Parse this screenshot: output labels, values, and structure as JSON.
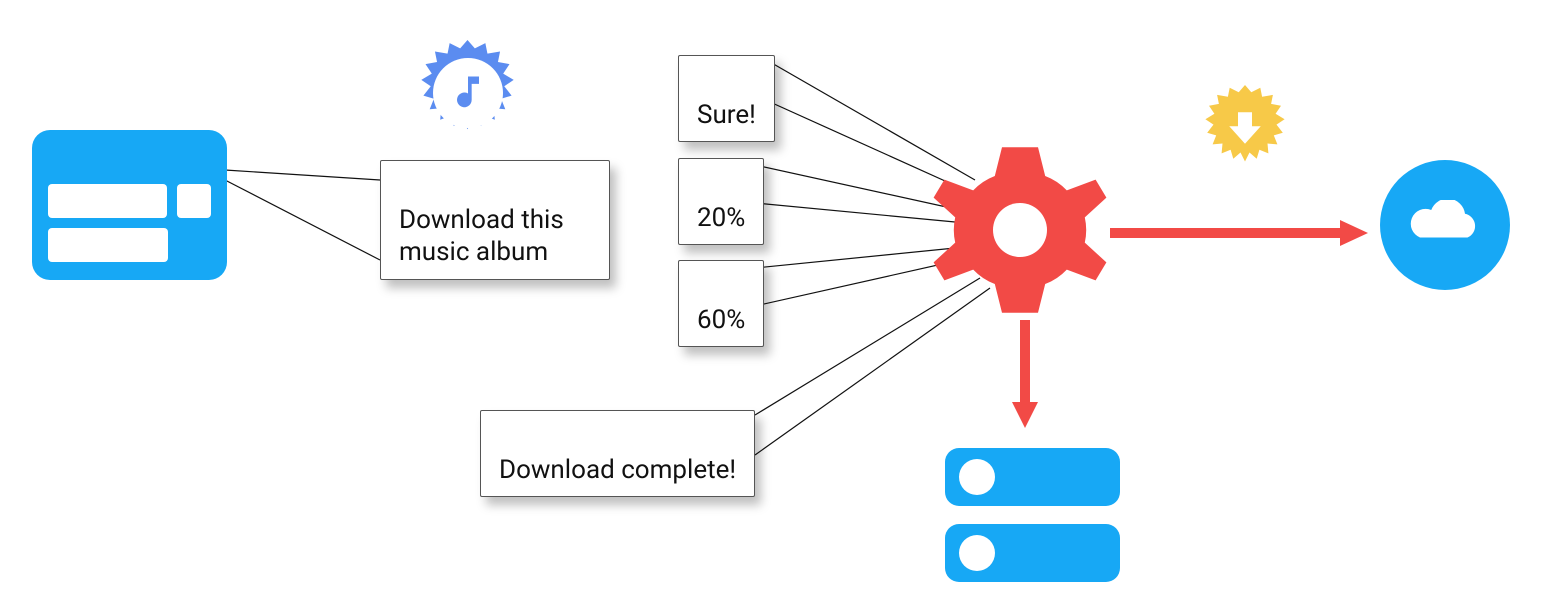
{
  "request": {
    "text": "Download this\nmusic album"
  },
  "responses": {
    "ack": "Sure!",
    "progress1": "20%",
    "progress2": "60%",
    "done": "Download complete!"
  },
  "badges": {
    "music": "music",
    "download": "download"
  },
  "colors": {
    "blue": "#17A8F5",
    "red": "#F24A46",
    "yellow": "#F7C948",
    "badgeBlue": "#5B8CF0"
  }
}
